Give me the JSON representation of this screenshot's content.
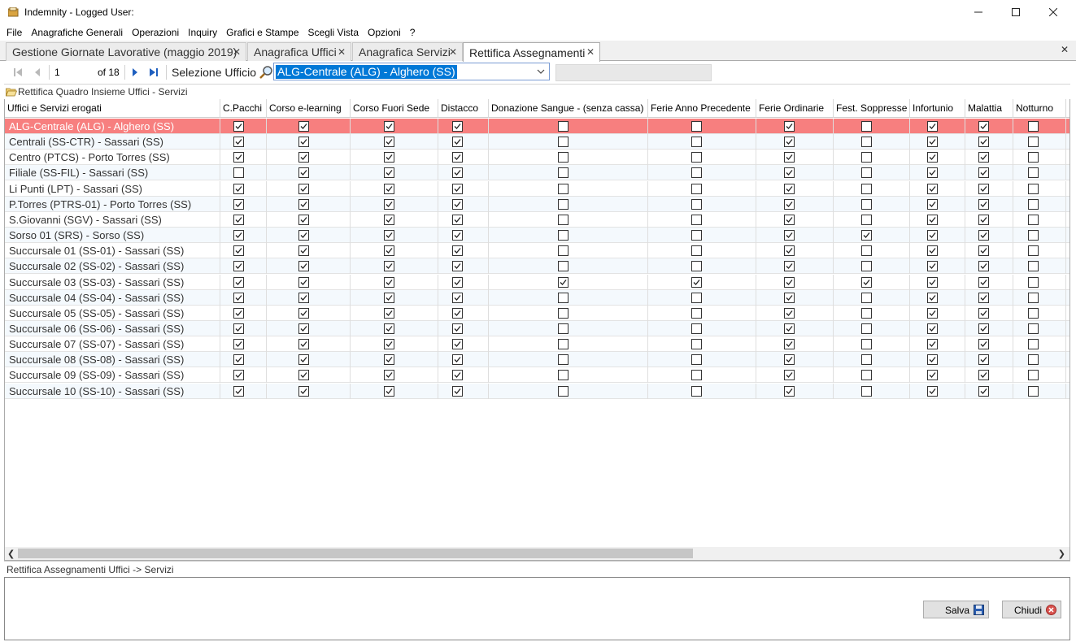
{
  "window": {
    "title": "Indemnity - Logged User:"
  },
  "menu": [
    "File",
    "Anagrafiche Generali",
    "Operazioni",
    "Inquiry",
    "Grafici e Stampe",
    "Scegli Vista",
    "Opzioni",
    "?"
  ],
  "tabs": [
    {
      "label": "Gestione Giornate Lavorative (maggio 2019)",
      "active": false
    },
    {
      "label": "Anagrafica Uffici",
      "active": false
    },
    {
      "label": "Anagrafica Servizi",
      "active": false
    },
    {
      "label": "Rettifica Assegnamenti",
      "active": true
    }
  ],
  "toolbar": {
    "page_value": "1",
    "page_of": "of 18",
    "selection_label": "Selezione Ufficio",
    "selected_office": "ALG-Centrale (ALG)  -  Alghero (SS)"
  },
  "group_header": "Rettifica Quadro Insieme Uffici - Servizi",
  "grid": {
    "name_header": "Uffici e Servizi erogati",
    "columns": [
      "C.Pacchi",
      "Corso e-learning",
      "Corso Fuori Sede",
      "Distacco",
      "Donazione Sangue - (senza cassa)",
      "Ferie Anno Precedente",
      "Ferie Ordinarie",
      "Fest. Soppresse",
      "Infortunio",
      "Malattia",
      "Notturno"
    ],
    "rows": [
      {
        "name": "ALG-Centrale (ALG)  -  Alghero (SS)",
        "checks": [
          1,
          1,
          1,
          1,
          0,
          0,
          1,
          0,
          1,
          1,
          0
        ],
        "selected": true
      },
      {
        "name": "Centrali (SS-CTR)  -  Sassari (SS)",
        "checks": [
          1,
          1,
          1,
          1,
          0,
          0,
          1,
          0,
          1,
          1,
          0
        ]
      },
      {
        "name": "Centro (PTCS)  -  Porto Torres (SS)",
        "checks": [
          1,
          1,
          1,
          1,
          0,
          0,
          1,
          0,
          1,
          1,
          0
        ]
      },
      {
        "name": "Filiale (SS-FIL)  -  Sassari (SS)",
        "checks": [
          0,
          1,
          1,
          1,
          0,
          0,
          1,
          0,
          1,
          1,
          0
        ]
      },
      {
        "name": "Li Punti (LPT)  -  Sassari (SS)",
        "checks": [
          1,
          1,
          1,
          1,
          0,
          0,
          1,
          0,
          1,
          1,
          0
        ]
      },
      {
        "name": "P.Torres (PTRS-01)  -  Porto Torres (SS)",
        "checks": [
          1,
          1,
          1,
          1,
          0,
          0,
          1,
          0,
          1,
          1,
          0
        ]
      },
      {
        "name": "S.Giovanni (SGV)  -  Sassari (SS)",
        "checks": [
          1,
          1,
          1,
          1,
          0,
          0,
          1,
          0,
          1,
          1,
          0
        ]
      },
      {
        "name": "Sorso 01 (SRS)  -  Sorso (SS)",
        "checks": [
          1,
          1,
          1,
          1,
          0,
          0,
          1,
          1,
          1,
          1,
          0
        ]
      },
      {
        "name": "Succursale 01 (SS-01)  -  Sassari (SS)",
        "checks": [
          1,
          1,
          1,
          1,
          0,
          0,
          1,
          0,
          1,
          1,
          0
        ]
      },
      {
        "name": "Succursale 02 (SS-02)  -  Sassari (SS)",
        "checks": [
          1,
          1,
          1,
          1,
          0,
          0,
          1,
          0,
          1,
          1,
          0
        ]
      },
      {
        "name": "Succursale 03 (SS-03)  -  Sassari (SS)",
        "checks": [
          1,
          1,
          1,
          1,
          1,
          1,
          1,
          1,
          1,
          1,
          0
        ]
      },
      {
        "name": "Succursale 04 (SS-04)  -  Sassari (SS)",
        "checks": [
          1,
          1,
          1,
          1,
          0,
          0,
          1,
          0,
          1,
          1,
          0
        ]
      },
      {
        "name": "Succursale 05 (SS-05)  -  Sassari (SS)",
        "checks": [
          1,
          1,
          1,
          1,
          0,
          0,
          1,
          0,
          1,
          1,
          0
        ]
      },
      {
        "name": "Succursale 06 (SS-06)  -  Sassari (SS)",
        "checks": [
          1,
          1,
          1,
          1,
          0,
          0,
          1,
          0,
          1,
          1,
          0
        ]
      },
      {
        "name": "Succursale 07 (SS-07)  -  Sassari (SS)",
        "checks": [
          1,
          1,
          1,
          1,
          0,
          0,
          1,
          0,
          1,
          1,
          0
        ]
      },
      {
        "name": "Succursale 08 (SS-08)  -  Sassari (SS)",
        "checks": [
          1,
          1,
          1,
          1,
          0,
          0,
          1,
          0,
          1,
          1,
          0
        ]
      },
      {
        "name": "Succursale 09 (SS-09)  -  Sassari (SS)",
        "checks": [
          1,
          1,
          1,
          1,
          0,
          0,
          1,
          0,
          1,
          1,
          0
        ]
      },
      {
        "name": "Succursale 10 (SS-10)  -  Sassari (SS)",
        "checks": [
          1,
          1,
          1,
          1,
          0,
          0,
          1,
          0,
          1,
          1,
          0
        ]
      }
    ]
  },
  "status_text": "Rettifica Assegnamenti Uffici -> Servizi",
  "buttons": {
    "save": "Salva",
    "close": "Chiudi"
  },
  "colors": {
    "selected_row": "#f77f7f",
    "selection_blue": "#0078d7",
    "alt_row": "#f4f9fd"
  }
}
